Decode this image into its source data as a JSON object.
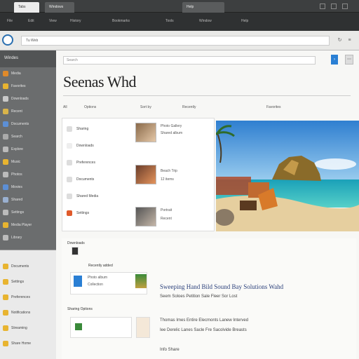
{
  "window": {
    "tabs": [
      "Tabs",
      "Windows",
      "Help"
    ],
    "menu": [
      "File",
      "Edit",
      "View",
      "History",
      "Bookmarks",
      "Tools",
      "Window",
      "Help"
    ]
  },
  "address": {
    "url": "Tu Web"
  },
  "sidebar": {
    "title": "Windes",
    "items": [
      {
        "label": "Media",
        "color": "#e08a2a"
      },
      {
        "label": "Favorites",
        "color": "#e8b430"
      },
      {
        "label": "Downloads",
        "color": "#c9c9c9"
      },
      {
        "label": "Recent",
        "color": "#d9b44a"
      },
      {
        "label": "Documents",
        "color": "#5c8fd6"
      },
      {
        "label": "Search",
        "color": "#aaaaaa"
      },
      {
        "label": "Explore",
        "color": "#bbbbbb"
      },
      {
        "label": "Music",
        "color": "#e8b430"
      },
      {
        "label": "Photos",
        "color": "#bbbbbb"
      },
      {
        "label": "Movies",
        "color": "#5c8fd6"
      },
      {
        "label": "Shared",
        "color": "#9ab0d0"
      },
      {
        "label": "Settings",
        "color": "#bbbbbb"
      },
      {
        "label": "Media Player",
        "color": "#e8b430"
      },
      {
        "label": "Library",
        "color": "#bbbbbb"
      }
    ],
    "lower_items": [
      {
        "label": "Documents",
        "color": "#e8b430"
      },
      {
        "label": "Settings",
        "color": "#e8b430"
      },
      {
        "label": "Preferences",
        "color": "#e8b430"
      },
      {
        "label": "Notifications",
        "color": "#e8b430"
      },
      {
        "label": "Streaming",
        "color": "#e8b430"
      },
      {
        "label": "Share Home",
        "color": "#e8b430"
      }
    ]
  },
  "main": {
    "search_placeholder": "Search",
    "title": "Seenas Whd",
    "filters": [
      "All",
      "Options",
      "Sort by",
      "Recently",
      "Favorites"
    ],
    "list": [
      {
        "label": "Sharing",
        "color": "#dddddd"
      },
      {
        "label": "Downloads",
        "color": "#eeeeee"
      },
      {
        "label": "Preferences",
        "color": "#dddddd"
      },
      {
        "label": "Documents",
        "color": "#dddddd"
      },
      {
        "label": "Shared Media",
        "color": "#dddddd"
      },
      {
        "label": "Settings",
        "color": "#e05a2a"
      }
    ],
    "thumbs": [
      {
        "label": "Photo Gallery",
        "sub": "Shared album"
      },
      {
        "label": "Beach Trip",
        "sub": "12 items"
      },
      {
        "label": "Portrait",
        "sub": "Recent"
      }
    ],
    "section2": {
      "header": "Downloads",
      "sub": "Recently added",
      "card1_lines": [
        "Photo album",
        "Collection"
      ],
      "big_line": "Sweeping Hand Bild Sound Bay Solutions Wahd",
      "small_line": "Seem Soloes Petition Sale Fleer Sor Lost",
      "sub_header": "Sharing Options",
      "line3": "Thomas Imes Entire Elecmonts Lanew Interved",
      "line4": "Iee Derelic Lanes Sacle Fre Sacolvide Breasts",
      "footer": "Info Share"
    }
  }
}
